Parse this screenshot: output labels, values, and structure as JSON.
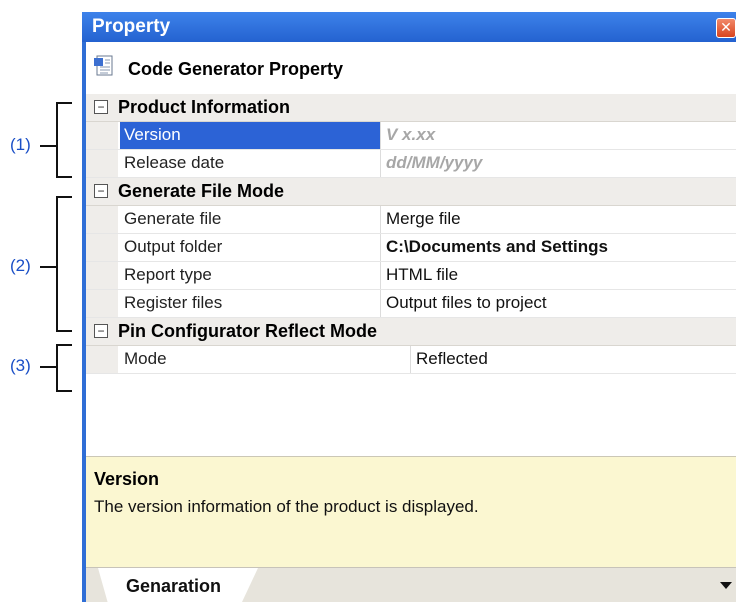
{
  "window": {
    "title": "Property",
    "close_glyph": "✕",
    "header_title": "Code Generator Property"
  },
  "callouts": [
    {
      "label": "(1)"
    },
    {
      "label": "(2)"
    },
    {
      "label": "(3)"
    }
  ],
  "categories": [
    {
      "label": "Product Information",
      "expander": "−",
      "rows": [
        {
          "name": "Version",
          "value": "V x.xx"
        },
        {
          "name": "Release date",
          "value": "dd/MM/yyyy"
        }
      ]
    },
    {
      "label": "Generate File Mode",
      "expander": "−",
      "rows": [
        {
          "name": "Generate file",
          "value": "Merge file"
        },
        {
          "name": "Output folder",
          "value": "C:\\Documents and Settings"
        },
        {
          "name": "Report type",
          "value": "HTML file"
        },
        {
          "name": "Register files",
          "value": "Output files to project"
        }
      ]
    },
    {
      "label": "Pin Configurator Reflect Mode",
      "expander": "−",
      "rows": [
        {
          "name": "Mode",
          "value": "Reflected"
        }
      ]
    }
  ],
  "description": {
    "title": "Version",
    "text": "The version information of the product is displayed."
  },
  "tabs": [
    {
      "label": "Genaration"
    }
  ],
  "colors": {
    "titlebar": "#2f6ed6",
    "selection": "#2c63d6",
    "callout_text": "#1a4fc7",
    "description_bg": "#fbf7d1"
  }
}
